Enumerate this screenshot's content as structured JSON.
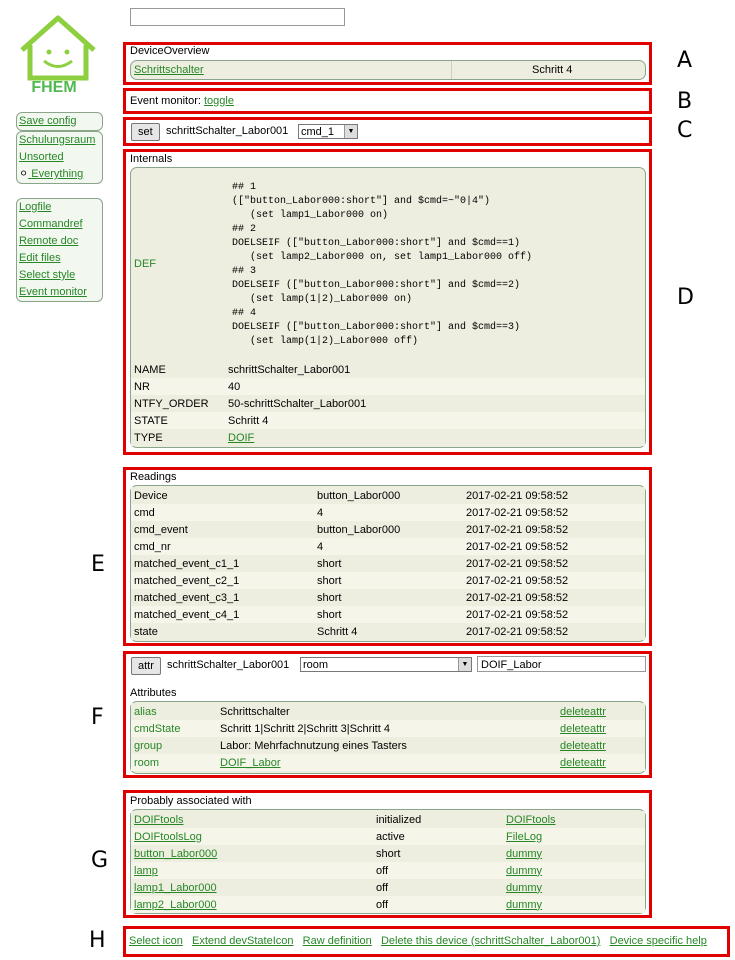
{
  "brand": {
    "name": "FHEM",
    "accent": "#52b852",
    "link": "#278727",
    "frame": "#e00000"
  },
  "menu": {
    "save": "Save config",
    "rooms": [
      "Schulungsraum",
      "Unsorted",
      "Everything"
    ],
    "links": [
      "Logfile",
      "Commandref",
      "Remote doc",
      "Edit files",
      "Select style",
      "Event monitor"
    ]
  },
  "overview": {
    "title": "DeviceOverview",
    "device": "Schrittschalter",
    "state": "Schritt 4"
  },
  "event": {
    "label": "Event monitor:",
    "link": "toggle"
  },
  "set": {
    "button": "set",
    "device": "schrittSchalter_Labor001",
    "command": "cmd_1"
  },
  "internals": {
    "title": "Internals",
    "def_key": "DEF",
    "def_value": "## 1\n([\"button_Labor000:short\"] and $cmd=~\"0|4\")\n   (set lamp1_Labor000 on)\n## 2\nDOELSEIF ([\"button_Labor000:short\"] and $cmd==1)\n   (set lamp2_Labor000 on, set lamp1_Labor000 off)\n## 3\nDOELSEIF ([\"button_Labor000:short\"] and $cmd==2)\n   (set lamp(1|2)_Labor000 on)\n## 4\nDOELSEIF ([\"button_Labor000:short\"] and $cmd==3)\n   (set lamp(1|2)_Labor000 off)",
    "rows": [
      {
        "key": "NAME",
        "value": "schrittSchalter_Labor001"
      },
      {
        "key": "NR",
        "value": "40"
      },
      {
        "key": "NTFY_ORDER",
        "value": "50-schrittSchalter_Labor001"
      },
      {
        "key": "STATE",
        "value": "Schritt 4"
      },
      {
        "key": "TYPE",
        "value": "DOIF"
      }
    ]
  },
  "readings": {
    "title": "Readings",
    "rows": [
      {
        "name": "Device",
        "value": "button_Labor000",
        "time": "2017-02-21 09:58:52"
      },
      {
        "name": "cmd",
        "value": "4",
        "time": "2017-02-21 09:58:52"
      },
      {
        "name": "cmd_event",
        "value": "button_Labor000",
        "time": "2017-02-21 09:58:52"
      },
      {
        "name": "cmd_nr",
        "value": "4",
        "time": "2017-02-21 09:58:52"
      },
      {
        "name": "matched_event_c1_1",
        "value": "short",
        "time": "2017-02-21 09:58:52"
      },
      {
        "name": "matched_event_c2_1",
        "value": "short",
        "time": "2017-02-21 09:58:52"
      },
      {
        "name": "matched_event_c3_1",
        "value": "short",
        "time": "2017-02-21 09:58:52"
      },
      {
        "name": "matched_event_c4_1",
        "value": "short",
        "time": "2017-02-21 09:58:52"
      },
      {
        "name": "state",
        "value": "Schritt 4",
        "time": "2017-02-21 09:58:52"
      }
    ]
  },
  "attr": {
    "button": "attr",
    "device": "schrittSchalter_Labor001",
    "select": "room",
    "value": "DOIF_Labor",
    "title": "Attributes",
    "delete_label": "deleteattr",
    "rows": [
      {
        "key": "alias",
        "value": "Schrittschalter",
        "link": false
      },
      {
        "key": "cmdState",
        "value": "Schritt 1|Schritt 2|Schritt 3|Schritt 4",
        "link": false
      },
      {
        "key": "group",
        "value": "Labor: Mehrfachnutzung eines Tasters",
        "link": false
      },
      {
        "key": "room",
        "value": "DOIF_Labor",
        "link": true
      }
    ]
  },
  "associated": {
    "title": "Probably associated with",
    "rows": [
      {
        "name": "DOIFtools",
        "state": "initialized",
        "type": "DOIFtools"
      },
      {
        "name": "DOIFtoolsLog",
        "state": "active",
        "type": "FileLog"
      },
      {
        "name": "button_Labor000",
        "state": "short",
        "type": "dummy"
      },
      {
        "name": "lamp",
        "state": "off",
        "type": "dummy"
      },
      {
        "name": "lamp1_Labor000",
        "state": "off",
        "type": "dummy"
      },
      {
        "name": "lamp2_Labor000",
        "state": "off",
        "type": "dummy"
      }
    ]
  },
  "footer": [
    "Select icon",
    "Extend devStateIcon",
    "Raw definition",
    "Delete this device (schrittSchalter_Labor001)",
    "Device specific help"
  ],
  "letters": [
    "A",
    "B",
    "C",
    "D",
    "E",
    "F",
    "G",
    "H"
  ]
}
